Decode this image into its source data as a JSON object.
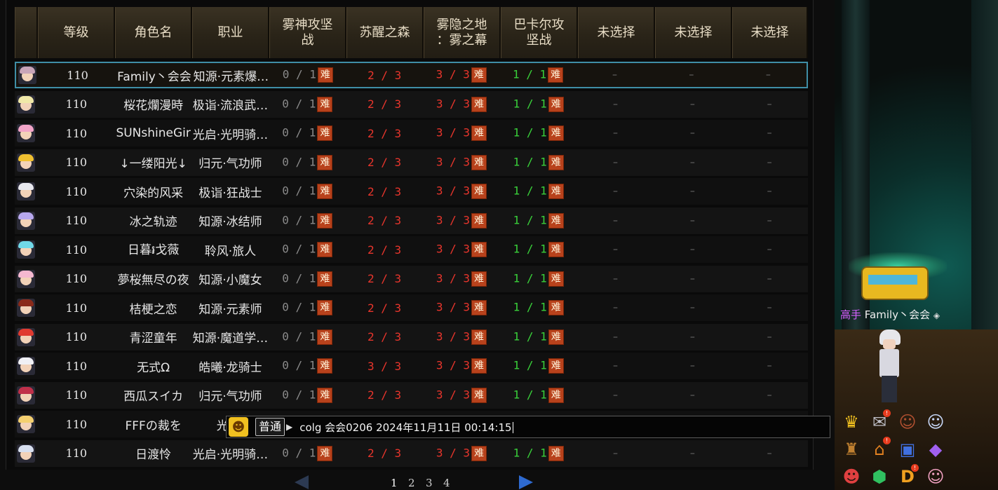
{
  "table": {
    "headers": [
      "等级",
      "角色名",
      "职业",
      "雾神攻坚\n战",
      "苏醒之森",
      "雾隐之地\n：雾之幕",
      "巴卡尔攻\n坚战",
      "未选择",
      "未选择",
      "未选择"
    ],
    "difficulty_badge": "难",
    "rows": [
      {
        "level": "110",
        "name": "Family丶会会",
        "job": "知源·元素爆…",
        "r1": "0 / 1",
        "r2": "2 / 3",
        "r3": "3 / 3",
        "r4": "1 / 1",
        "e1": "–",
        "e2": "–",
        "e3": "–",
        "hair": "#c9a5b8"
      },
      {
        "level": "110",
        "name": "桜花爛漫時",
        "job": "极诣·流浪武…",
        "r1": "0 / 1",
        "r2": "2 / 3",
        "r3": "3 / 3",
        "r4": "1 / 1",
        "e1": "–",
        "e2": "–",
        "e3": "–",
        "hair": "#f0e8a8"
      },
      {
        "level": "110",
        "name": "SUNshineGir",
        "job": "光启·光明骑…",
        "r1": "0 / 1",
        "r2": "2 / 3",
        "r3": "3 / 3",
        "r4": "1 / 1",
        "e1": "–",
        "e2": "–",
        "e3": "–",
        "hair": "#f2a4c8"
      },
      {
        "level": "110",
        "name": "↓一缕阳光↓",
        "job": "归元·气功师",
        "r1": "0 / 1",
        "r2": "2 / 3",
        "r3": "3 / 3",
        "r4": "1 / 1",
        "e1": "–",
        "e2": "–",
        "e3": "–",
        "hair": "#f0c030"
      },
      {
        "level": "110",
        "name": "穴染的风采",
        "job": "极诣·狂战士",
        "r1": "0 / 1",
        "r2": "2 / 3",
        "r3": "3 / 3",
        "r4": "1 / 1",
        "e1": "–",
        "e2": "–",
        "e3": "–",
        "hair": "#e8e8ee"
      },
      {
        "level": "110",
        "name": "冰之轨迹",
        "job": "知源·冰结师",
        "r1": "0 / 1",
        "r2": "2 / 3",
        "r3": "3 / 3",
        "r4": "1 / 1",
        "e1": "–",
        "e2": "–",
        "e3": "–",
        "hair": "#b8a8ee"
      },
      {
        "level": "110",
        "name": "日暮៛戈薇",
        "job": "聆风·旅人",
        "r1": "0 / 1",
        "r2": "2 / 3",
        "r3": "3 / 3",
        "r4": "1 / 1",
        "e1": "–",
        "e2": "–",
        "e3": "–",
        "hair": "#70d8e8"
      },
      {
        "level": "110",
        "name": "夢桜無尽の夜",
        "job": "知源·小魔女",
        "r1": "0 / 1",
        "r2": "2 / 3",
        "r3": "3 / 3",
        "r4": "1 / 1",
        "e1": "–",
        "e2": "–",
        "e3": "–",
        "hair": "#f4b8d0"
      },
      {
        "level": "110",
        "name": "桔梗之恋",
        "job": "知源·元素师",
        "r1": "0 / 1",
        "r2": "2 / 3",
        "r3": "3 / 3",
        "r4": "1 / 1",
        "e1": "–",
        "e2": "–",
        "e3": "–",
        "hair": "#8a2a1a"
      },
      {
        "level": "110",
        "name": "青涩童年",
        "job": "知源·魔道学…",
        "r1": "0 / 1",
        "r2": "2 / 3",
        "r3": "3 / 3",
        "r4": "1 / 1",
        "e1": "–",
        "e2": "–",
        "e3": "–",
        "hair": "#e03a30"
      },
      {
        "level": "110",
        "name": "无式Ω",
        "job": "皓曦·龙骑士",
        "r1": "0 / 1",
        "r2": "3 / 3",
        "r3": "3 / 3",
        "r4": "1 / 1",
        "e1": "–",
        "e2": "–",
        "e3": "–",
        "hair": "#f0f0f4"
      },
      {
        "level": "110",
        "name": "西瓜スイカ",
        "job": "归元·气功师",
        "r1": "0 / 1",
        "r2": "2 / 3",
        "r3": "3 / 3",
        "r4": "1 / 1",
        "e1": "–",
        "e2": "–",
        "e3": "–",
        "hair": "#c0304a"
      },
      {
        "level": "110",
        "name": "FFFの裁を",
        "job": "光启·",
        "r1": "",
        "r2": "",
        "r3": "",
        "r4": "",
        "e1": "",
        "e2": "",
        "e3": "",
        "hair": "#f4d070"
      },
      {
        "level": "110",
        "name": "日渡怜",
        "job": "光启·光明骑…",
        "r1": "0 / 1",
        "r2": "2 / 3",
        "r3": "3 / 3",
        "r4": "1 / 1",
        "e1": "–",
        "e2": "–",
        "e3": "–",
        "hair": "#d8e0f0"
      }
    ]
  },
  "chat": {
    "channel": "普通",
    "text": "colg 会会0206 2024年11月11日 00:14:15"
  },
  "pager": {
    "pages": [
      "1",
      "2",
      "3",
      "4"
    ]
  },
  "player": {
    "rank": "高手",
    "name": "Family丶会会"
  },
  "colors": {
    "accent_selected": "#3f8ea6",
    "red": "#e8352c",
    "green": "#39d13a",
    "badge": "#b8421c"
  }
}
